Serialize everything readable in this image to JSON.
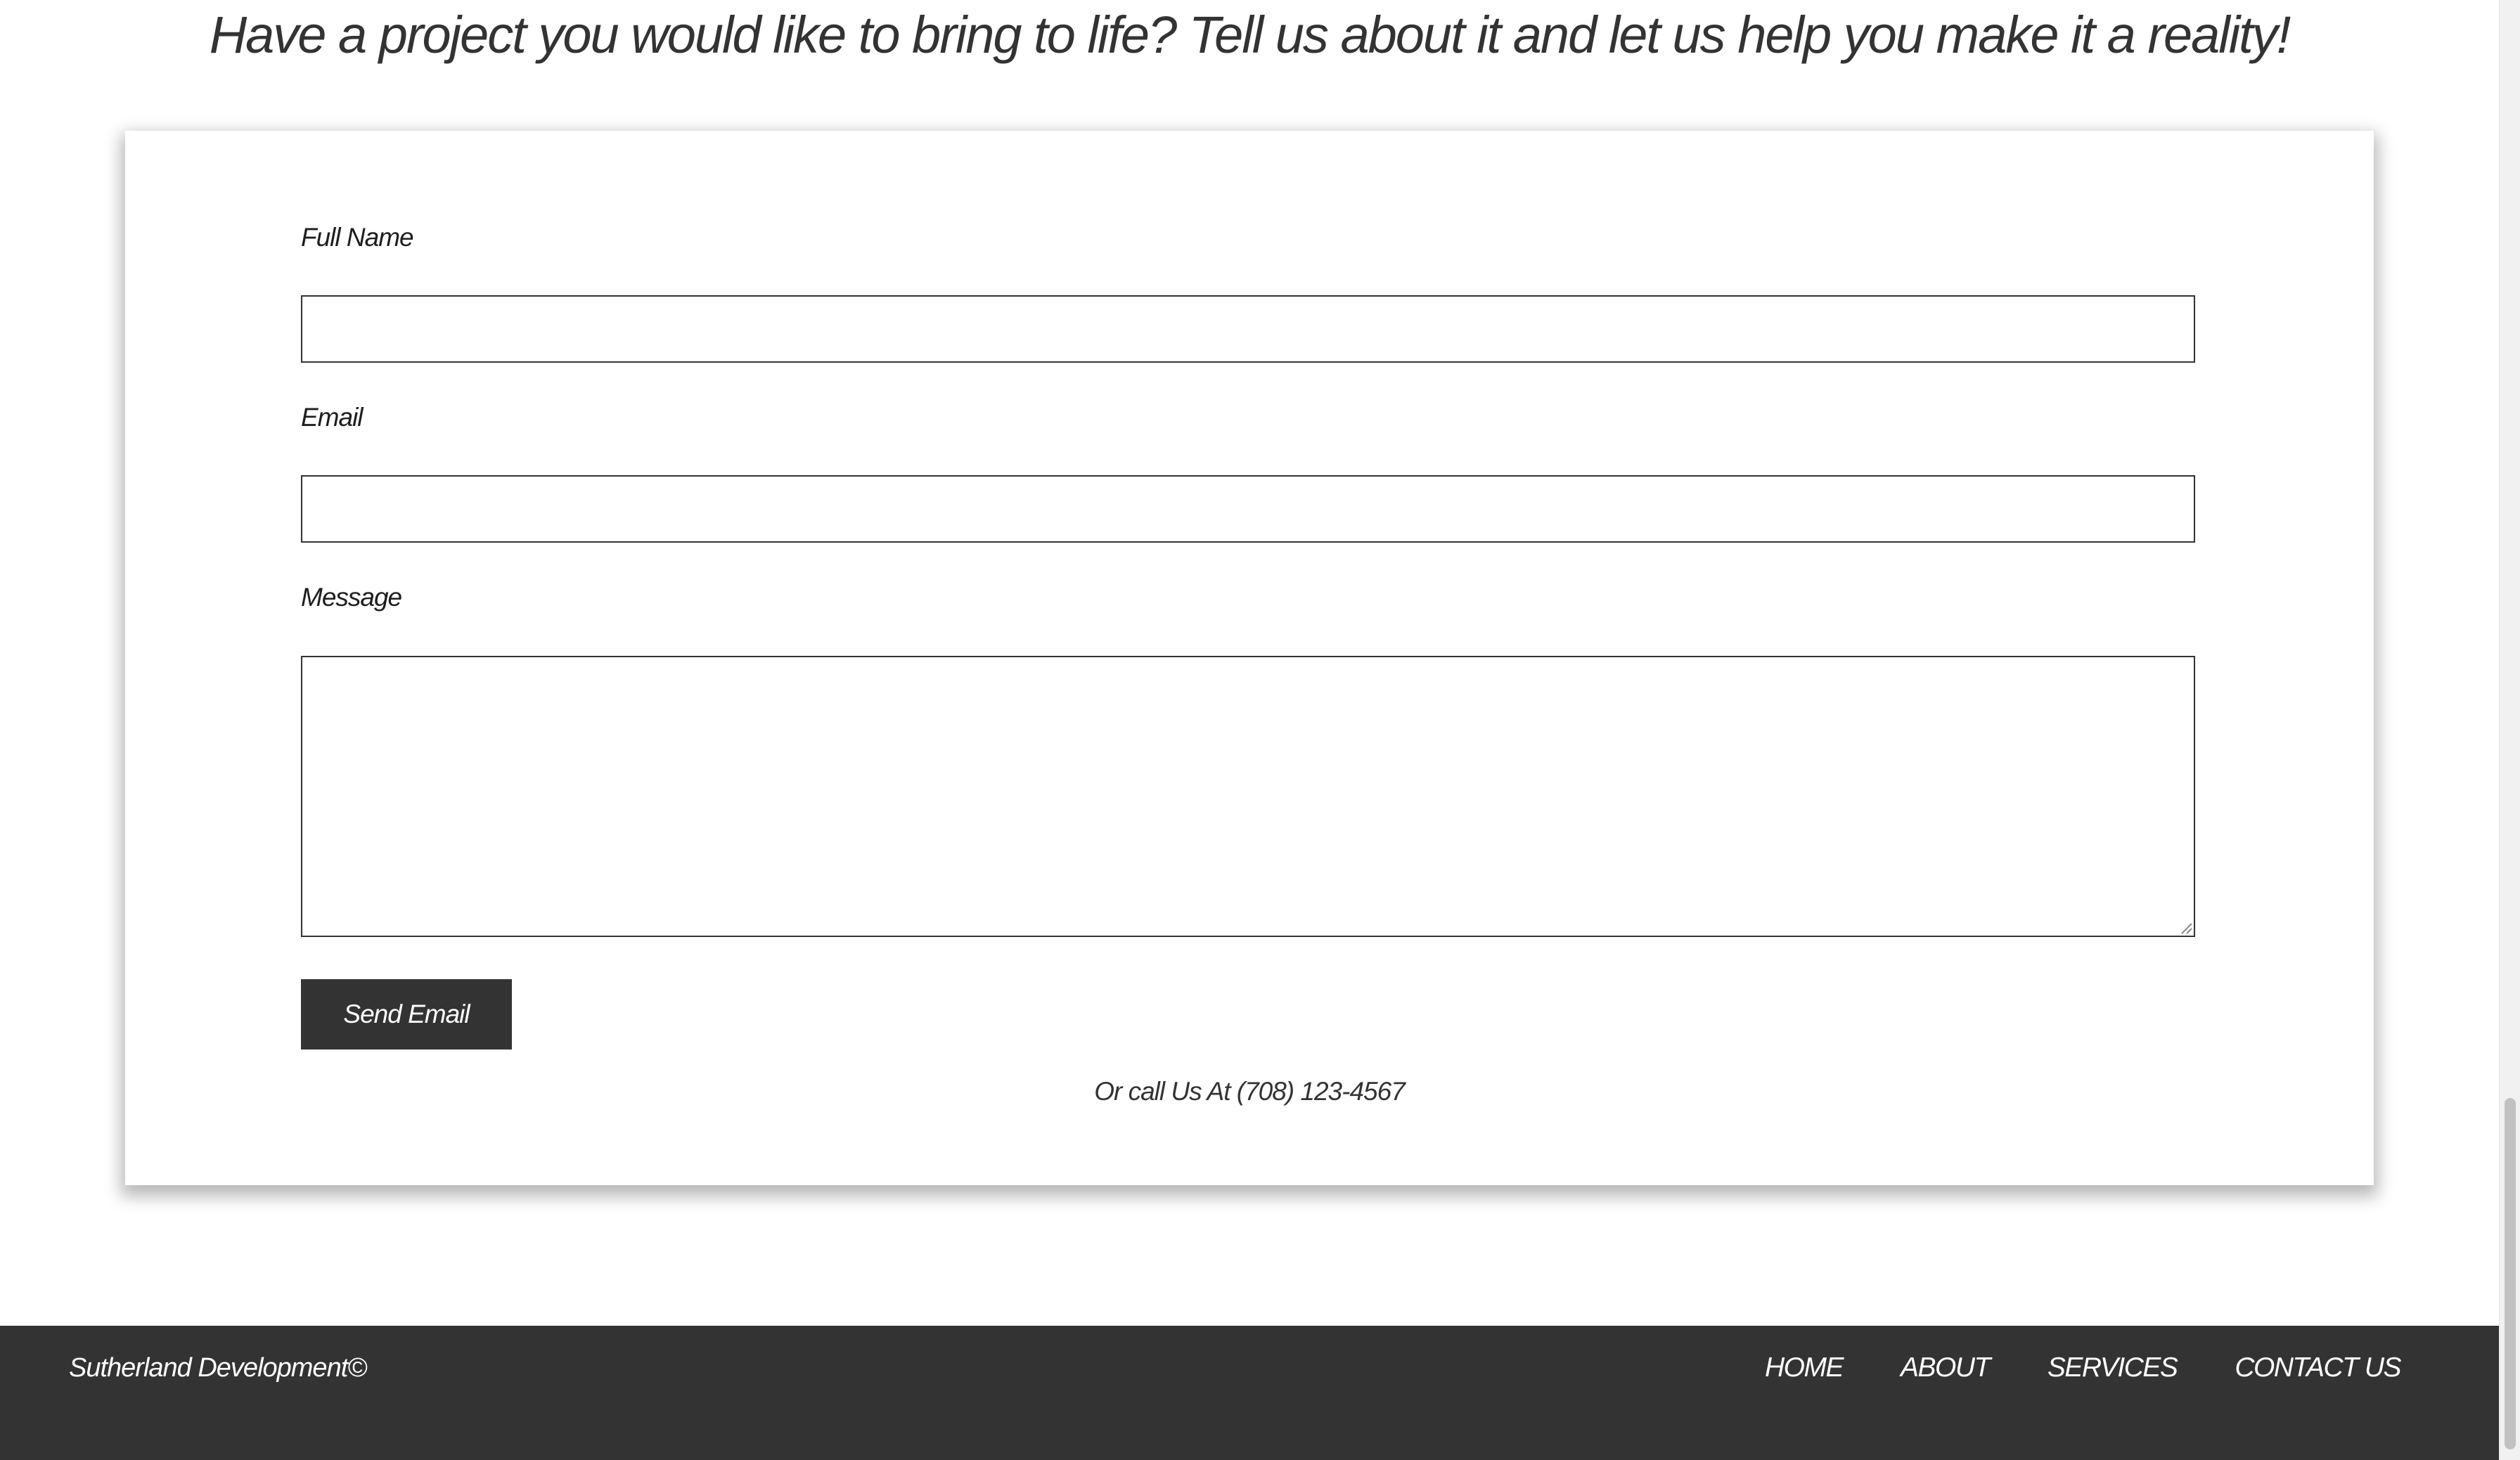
{
  "page": {
    "headline": "Have a project you would like to bring to life? Tell us about it and let us help you make it a reality!"
  },
  "contact_form": {
    "full_name_label": "Full Name",
    "full_name_value": "",
    "email_label": "Email",
    "email_value": "",
    "message_label": "Message",
    "message_value": "",
    "send_button_label": "Send Email",
    "call_text": "Or call Us At (708) 123-4567"
  },
  "footer": {
    "brand": "Sutherland Development©",
    "nav": [
      {
        "label": "HOME"
      },
      {
        "label": "ABOUT"
      },
      {
        "label": "SERVICES"
      },
      {
        "label": "CONTACT US"
      }
    ]
  },
  "colors": {
    "dark": "#333333",
    "background": "#ffffff",
    "scrollbar_thumb": "#c1c1c1"
  },
  "icons": {
    "textarea_resize": "resize-grip-icon"
  }
}
